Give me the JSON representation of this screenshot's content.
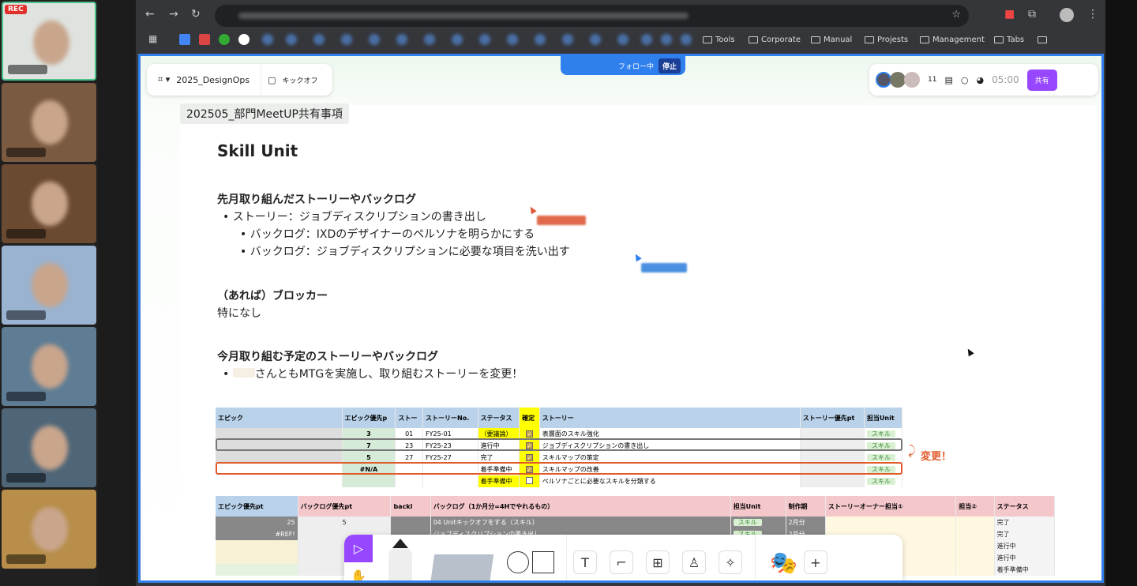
{
  "meeting": {
    "rec_label": "REC",
    "tile_count": 7
  },
  "browser": {
    "bookmarks": [
      "Tools",
      "Corporate",
      "Manual",
      "Projests",
      "Management",
      "Tabs",
      ""
    ]
  },
  "figjam": {
    "file_name": "2025_DesignOps",
    "page_name": "キックオフ",
    "follow_label": "フォロー中",
    "stop_label": "停止",
    "collaborator_count": "11",
    "timer": "05:00",
    "share_label": "共有"
  },
  "doc": {
    "section_title": "202505_部門MeetUP共有事項",
    "title": "Skill Unit",
    "last_month_heading": "先月取り組んだストーリーやバックログ",
    "story": "ストーリー：ジョブディスクリプションの書き出し",
    "backlogs": [
      "バックログ：IXDのデザイナーのペルソナを明らかにする",
      "バックログ：ジョブディスクリプションに必要な項目を洗い出す"
    ],
    "blocker_heading": "（あれば）ブロッカー",
    "blocker_text": "特になし",
    "this_month_heading": "今月取り組む予定のストーリーやバックログ",
    "this_month_item": "さんともMTGを実施し、取り組むストーリーを変更！",
    "change_note": "変更！"
  },
  "table1": {
    "headers": [
      "エピック",
      "エピック優先p",
      "ストー",
      "ストーリーNo.",
      "ステータス",
      "確定",
      "ストーリー",
      "ストーリー優先pt",
      "担当Unit"
    ],
    "rows": [
      {
        "priority": "3",
        "num": "01",
        "no": "FY25-01",
        "status": "（要議論）",
        "checked": true,
        "story": "表層面のスキル強化",
        "unit": "スキル"
      },
      {
        "priority": "7",
        "num": "23",
        "no": "FY25-23",
        "status": "進行中",
        "checked": true,
        "story": "ジョブディスクリプションの書き出し",
        "unit": "スキル"
      },
      {
        "priority": "5",
        "num": "27",
        "no": "FY25-27",
        "status": "完了",
        "checked": true,
        "story": "スキルマップの策定",
        "unit": "スキル"
      },
      {
        "priority": "#N/A",
        "num": "",
        "no": "",
        "status": "着手準備中",
        "checked": true,
        "story": "スキルマップの改善",
        "unit": "スキル"
      },
      {
        "priority": "",
        "num": "",
        "no": "",
        "status": "着手準備中",
        "checked": false,
        "story": "ペルソナごとに必要なスキルを分類する",
        "unit": "スキル"
      }
    ]
  },
  "table2": {
    "headers": [
      "エピック優先pt",
      "バックログ優先pt",
      "backl",
      "バックログ（1か月分=4Hでやれるもの）",
      "担当Unit",
      "制作期",
      "ストーリーオーナー担当①",
      "担当②",
      "ステータス"
    ],
    "rows": [
      {
        "epic_pt": "25",
        "pt": "5",
        "backlog": "04 Unitキックオフをする（スキル）",
        "unit": "スキル",
        "period": "2月分",
        "status": "完了"
      },
      {
        "epic_pt": "#REF!",
        "pt": "",
        "backlog": "ジョブディスクリプションの書き出し",
        "unit": "スキル",
        "period": "2月分",
        "status": "完了"
      },
      {
        "epic_pt": "",
        "pt": "",
        "backlog": "",
        "unit": "",
        "period": "",
        "status": "進行中"
      },
      {
        "epic_pt": "",
        "pt": "",
        "backlog": "",
        "unit": "",
        "period": "",
        "status": "進行中"
      },
      {
        "epic_pt": "",
        "pt": "",
        "backlog": "",
        "unit": "",
        "period": "",
        "status": "着手準備中"
      }
    ]
  }
}
